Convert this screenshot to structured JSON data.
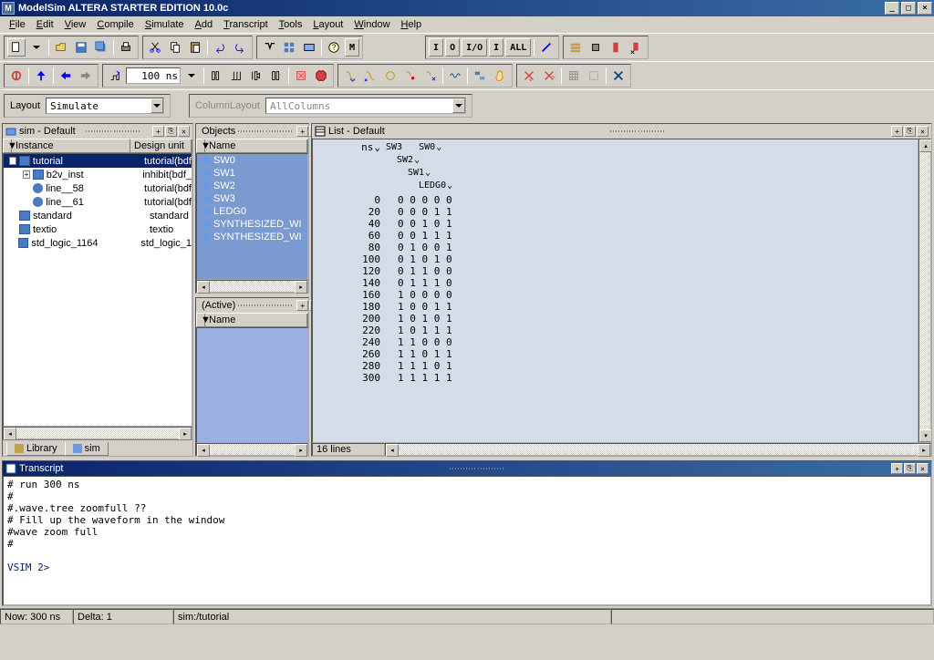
{
  "window": {
    "title": "ModelSim ALTERA STARTER EDITION 10.0c",
    "icon_letter": "M"
  },
  "menu": [
    "File",
    "Edit",
    "View",
    "Compile",
    "Simulate",
    "Add",
    "Transcript",
    "Tools",
    "Layout",
    "Window",
    "Help"
  ],
  "toolbar": {
    "time_value": "100 ns",
    "io_buttons": [
      "I",
      "O",
      "I/O",
      "I",
      "ALL"
    ]
  },
  "layout_row": {
    "layout_label": "Layout",
    "layout_value": "Simulate",
    "columnlayout_label": "ColumnLayout",
    "columnlayout_value": "AllColumns"
  },
  "sim_panel": {
    "title": "sim - Default",
    "columns": [
      "Instance",
      "Design unit"
    ],
    "rows": [
      {
        "indent": 0,
        "exp": "-",
        "icon": "box",
        "name": "tutorial",
        "du": "tutorial(bdf",
        "sel": true
      },
      {
        "indent": 1,
        "exp": "+",
        "icon": "box",
        "name": "b2v_inst",
        "du": "inhibit(bdf_"
      },
      {
        "indent": 1,
        "exp": "",
        "icon": "circ",
        "name": "line__58",
        "du": "tutorial(bdf"
      },
      {
        "indent": 1,
        "exp": "",
        "icon": "circ",
        "name": "line__61",
        "du": "tutorial(bdf"
      },
      {
        "indent": 0,
        "exp": "",
        "icon": "box",
        "name": "standard",
        "du": "standard"
      },
      {
        "indent": 0,
        "exp": "",
        "icon": "box",
        "name": "textio",
        "du": "textio"
      },
      {
        "indent": 0,
        "exp": "",
        "icon": "box",
        "name": "std_logic_1164",
        "du": "std_logic_1"
      }
    ],
    "tabs": [
      "Library",
      "sim"
    ],
    "active_tab": "sim"
  },
  "objects_panel": {
    "title": "Objects",
    "column": "Name",
    "items": [
      "SW0",
      "SW1",
      "SW2",
      "SW3",
      "LEDG0",
      "SYNTHESIZED_WI",
      "SYNTHESIZED_WI"
    ]
  },
  "active_panel": {
    "title": "(Active)",
    "column": "Name"
  },
  "list_panel": {
    "title": "List - Default",
    "ns_label": "ns",
    "signals_l1": "SW3   SW0",
    "signals_l2": "SW2",
    "signals_l3": "SW1",
    "signals_l4": "LEDG0",
    "status": "16 lines"
  },
  "chart_data": {
    "type": "table",
    "title": "List - Default",
    "xlabel": "ns",
    "columns": [
      "ns",
      "SW3",
      "SW2",
      "SW1",
      "SW0",
      "LEDG0"
    ],
    "rows": [
      {
        "t": 0,
        "v": [
          0,
          0,
          0,
          0,
          0
        ]
      },
      {
        "t": 20,
        "v": [
          0,
          0,
          0,
          1,
          1
        ]
      },
      {
        "t": 40,
        "v": [
          0,
          0,
          1,
          0,
          1
        ]
      },
      {
        "t": 60,
        "v": [
          0,
          0,
          1,
          1,
          1
        ]
      },
      {
        "t": 80,
        "v": [
          0,
          1,
          0,
          0,
          1
        ]
      },
      {
        "t": 100,
        "v": [
          0,
          1,
          0,
          1,
          0
        ]
      },
      {
        "t": 120,
        "v": [
          0,
          1,
          1,
          0,
          0
        ]
      },
      {
        "t": 140,
        "v": [
          0,
          1,
          1,
          1,
          0
        ]
      },
      {
        "t": 160,
        "v": [
          1,
          0,
          0,
          0,
          0
        ]
      },
      {
        "t": 180,
        "v": [
          1,
          0,
          0,
          1,
          1
        ]
      },
      {
        "t": 200,
        "v": [
          1,
          0,
          1,
          0,
          1
        ]
      },
      {
        "t": 220,
        "v": [
          1,
          0,
          1,
          1,
          1
        ]
      },
      {
        "t": 240,
        "v": [
          1,
          1,
          0,
          0,
          0
        ]
      },
      {
        "t": 260,
        "v": [
          1,
          1,
          0,
          1,
          1
        ]
      },
      {
        "t": 280,
        "v": [
          1,
          1,
          1,
          0,
          1
        ]
      },
      {
        "t": 300,
        "v": [
          1,
          1,
          1,
          1,
          1
        ]
      }
    ]
  },
  "transcript": {
    "title": "Transcript",
    "lines": [
      "# run 300 ns",
      "#",
      "#.wave.tree zoomfull ??",
      "# Fill up the waveform in the window",
      "#wave zoom full",
      "#"
    ],
    "prompt": "VSIM 2>"
  },
  "status_bar": {
    "now": "Now: 300 ns",
    "delta": "Delta: 1",
    "context": "sim:/tutorial"
  }
}
